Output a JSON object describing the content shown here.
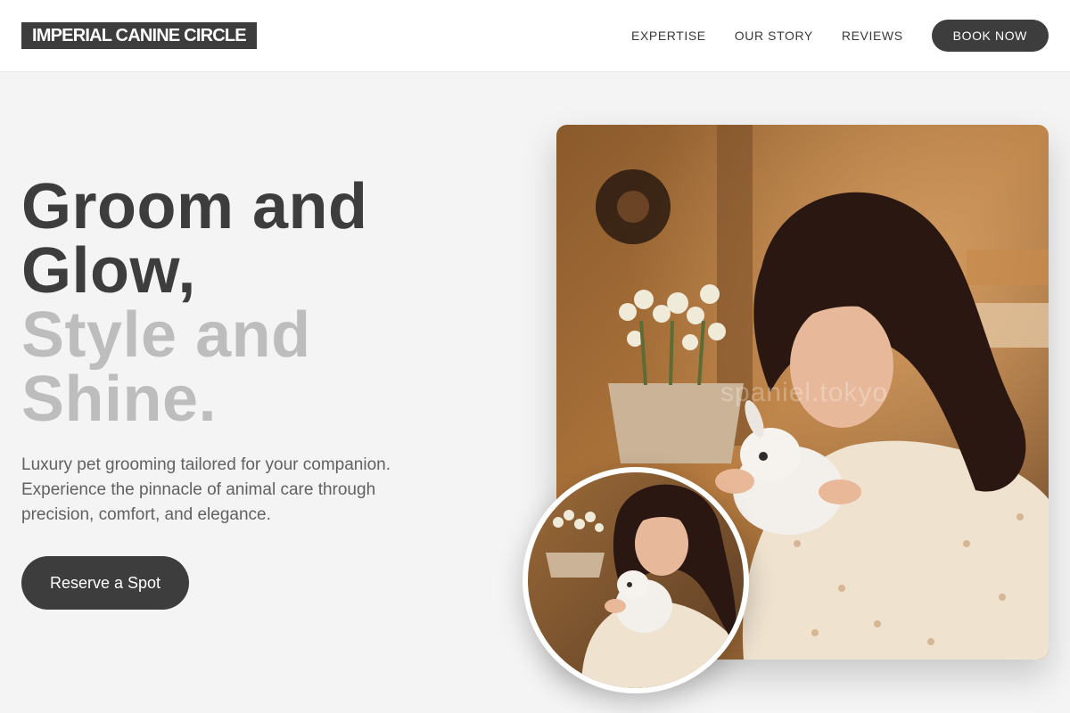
{
  "header": {
    "logo": "IMPERIAL CANINE CIRCLE",
    "nav": [
      "EXPERTISE",
      "OUR STORY",
      "REVIEWS"
    ],
    "cta": "BOOK NOW"
  },
  "hero": {
    "title_dark": [
      "Groom and",
      "Glow,"
    ],
    "title_light": [
      "Style and",
      "Shine."
    ],
    "description": "Luxury pet grooming tailored for your companion. Experience the pinnacle of animal care through precision, comfort, and elegance.",
    "cta": "Reserve a Spot"
  },
  "watermark": "spaniel.tokyo",
  "colors": {
    "page_bg": "#f4f4f4",
    "dark": "#3d3d3d",
    "light_heading": "#bdbdbd"
  }
}
